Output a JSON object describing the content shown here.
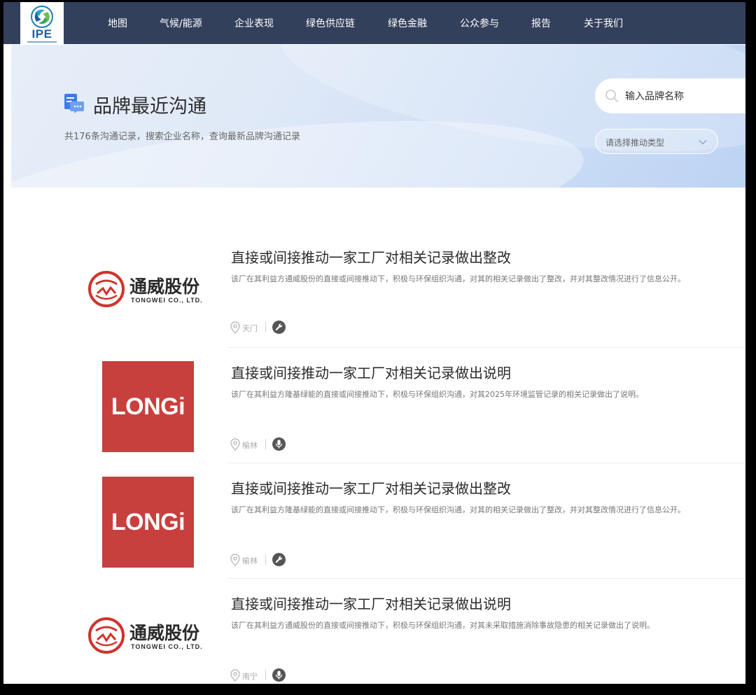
{
  "nav": {
    "logo_text": "IPE",
    "items": [
      "地图",
      "气候/能源",
      "企业表现",
      "绿色供应链",
      "绿色金融",
      "公众参与",
      "报告",
      "关于我们"
    ]
  },
  "hero": {
    "title": "品牌最近沟通",
    "subtitle": "共176条沟通记录，搜索企业名称，查询最新品牌沟通记录",
    "search_placeholder": "输入品牌名称",
    "select_placeholder": "请选择推动类型"
  },
  "records": [
    {
      "brand": "tongwei",
      "brand_name_cn": "通威股份",
      "brand_name_en": "TONGWEI CO., LTD.",
      "title": "直接或间接推动一家工厂对相关记录做出整改",
      "desc": "该厂在其利益方通威股份的直接或间接推动下，积极与环保组织沟通，对其的相关记录做出了整改，并对其整改情况进行了信息公开。",
      "city": "天门",
      "type_icon": "wrench-icon"
    },
    {
      "brand": "longi",
      "brand_name_en": "LONGi",
      "title": "直接或间接推动一家工厂对相关记录做出说明",
      "desc": "该厂在其利益方隆基绿能的直接或间接推动下，积极与环保组织沟通，对其2025年环境监管记录的相关记录做出了说明。",
      "city": "榆林",
      "type_icon": "microphone-icon"
    },
    {
      "brand": "longi",
      "brand_name_en": "LONGi",
      "title": "直接或间接推动一家工厂对相关记录做出整改",
      "desc": "该厂在其利益方隆基绿能的直接或间接推动下，积极与环保组织沟通，对其的相关记录做出了整改，并对其整改情况进行了信息公开。",
      "city": "榆林",
      "type_icon": "wrench-icon"
    },
    {
      "brand": "tongwei",
      "brand_name_cn": "通威股份",
      "brand_name_en": "TONGWEI CO., LTD.",
      "title": "直接或间接推动一家工厂对相关记录做出说明",
      "desc": "该厂在其利益方通威股份的直接或间接推动下，积极与环保组织沟通，对其未采取措施消除事故隐患的相关记录做出了说明。",
      "city": "南宁",
      "type_icon": "microphone-icon"
    }
  ],
  "colors": {
    "nav_bg": "#33405c",
    "longi_red": "#c8403e",
    "tongwei_red": "#d0332c",
    "ipe_blue": "#1c5f9a"
  }
}
